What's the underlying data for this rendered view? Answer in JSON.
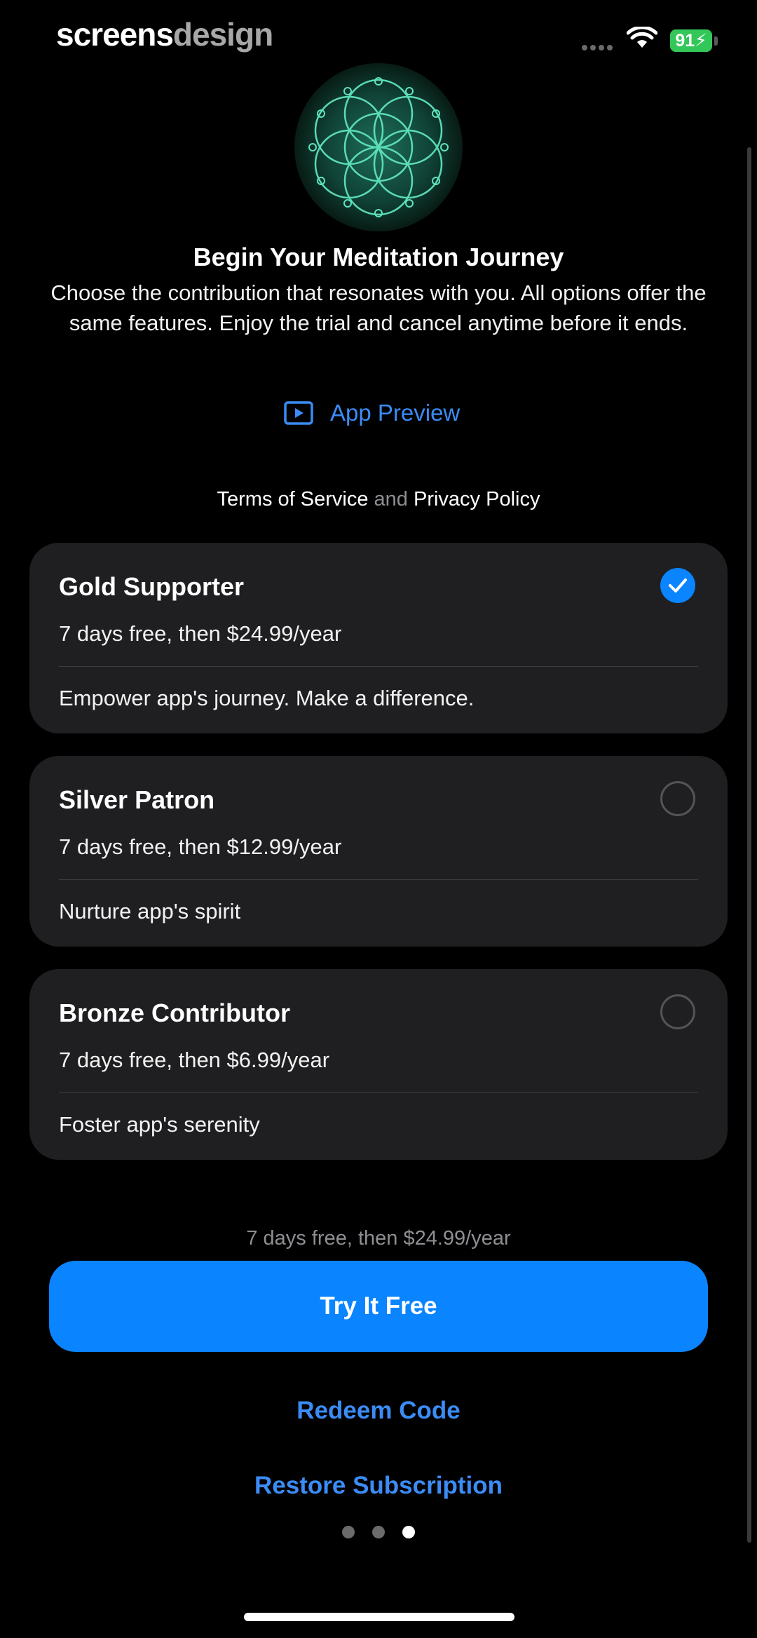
{
  "status_bar": {
    "brand_primary": "screens",
    "brand_secondary": "design",
    "battery": "91",
    "wifi_icon": "wifi-icon",
    "signal_icon": "signal-dots-icon"
  },
  "hero": {
    "icon": "flower-of-life-icon",
    "accent": "#3fd1a8"
  },
  "header": {
    "title": "Begin Your Meditation Journey",
    "subtitle": "Choose the contribution that resonates with you. All options offer the same features. Enjoy the trial and cancel anytime before it ends."
  },
  "app_preview": {
    "label": "App Preview",
    "icon": "play-rectangle-icon"
  },
  "legal": {
    "terms": "Terms of Service",
    "and": "and",
    "privacy": "Privacy Policy"
  },
  "plans": [
    {
      "name": "Gold Supporter",
      "price": "7 days free, then $24.99/year",
      "description": "Empower app's journey. Make a difference.",
      "selected": true
    },
    {
      "name": "Silver Patron",
      "price": "7 days free, then $12.99/year",
      "description": "Nurture app's spirit",
      "selected": false
    },
    {
      "name": "Bronze Contributor",
      "price": "7 days free, then $6.99/year",
      "description": "Foster app's serenity",
      "selected": false
    }
  ],
  "footer": {
    "price_note": "7 days free, then $24.99/year",
    "cta": "Try It Free",
    "redeem": "Redeem Code",
    "restore": "Restore Subscription"
  },
  "pager": {
    "count": 3,
    "active": 3
  },
  "colors": {
    "accent": "#0a84ff",
    "link": "#3b8cf6",
    "card": "#1f1f21",
    "battery": "#33c759"
  }
}
